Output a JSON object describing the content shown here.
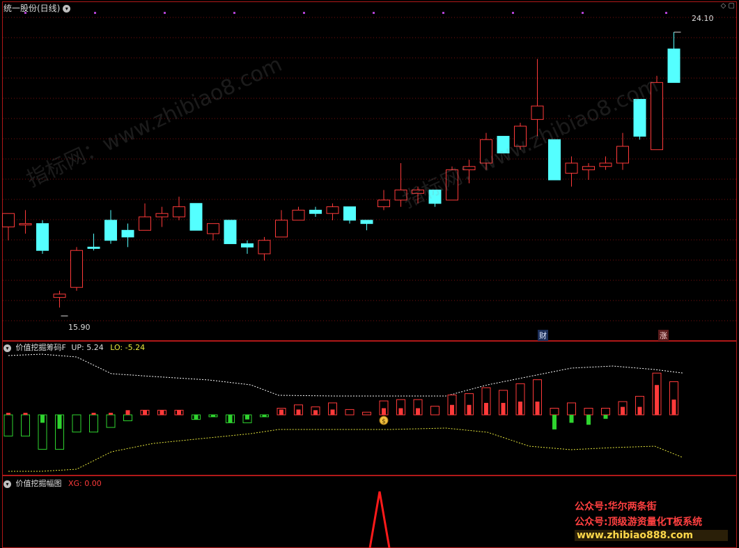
{
  "top_panel": {
    "title": "统一股份(日线)",
    "high_label": "24.10",
    "low_label": "15.90",
    "badge_cai": "财",
    "badge_zhang": "涨",
    "corner_icons": "◇ ▢"
  },
  "mid_panel": {
    "name": "价值挖掘筹码F",
    "up_label": "UP: 5.24",
    "lo_label": "LO: -5.24",
    "money_glyph": "$"
  },
  "bot_panel": {
    "name": "价值挖掘幅图",
    "xg_label": "XG: 0.00"
  },
  "promo": {
    "line1": "公众号:华尔两条街",
    "line2": "公众号:顶级游资量化T板系统",
    "line3": "www.zhibiao888.com"
  },
  "watermark": {
    "text1": "指标网：www.zhibiao",
    "text2": "8.com"
  },
  "colors": {
    "up": "#ff3a3a",
    "down": "#54ffff",
    "border": "#b01818",
    "grid": "#7a1010",
    "ma": "#ffffff",
    "green": "#2fd42f",
    "promo1": "#ff4040",
    "promo3": "#ffd84a"
  },
  "chart_data": [
    {
      "type": "candlestick",
      "ylim": [
        15.3,
        24.6
      ],
      "grid": true,
      "high_marker": 24.1,
      "low_marker": 15.9,
      "candles": [
        {
          "o": 18.3,
          "h": 18.6,
          "l": 17.9,
          "c": 18.7,
          "dir": "up"
        },
        {
          "o": 18.4,
          "h": 18.8,
          "l": 18.1,
          "c": 18.4,
          "dir": "up"
        },
        {
          "o": 18.4,
          "h": 18.5,
          "l": 17.5,
          "c": 17.6,
          "dir": "down"
        },
        {
          "o": 16.2,
          "h": 16.4,
          "l": 15.9,
          "c": 16.3,
          "dir": "up"
        },
        {
          "o": 16.5,
          "h": 17.7,
          "l": 16.4,
          "c": 17.6,
          "dir": "up"
        },
        {
          "o": 17.7,
          "h": 18.1,
          "l": 17.6,
          "c": 17.7,
          "dir": "down"
        },
        {
          "o": 18.5,
          "h": 18.8,
          "l": 17.8,
          "c": 17.9,
          "dir": "down"
        },
        {
          "o": 18.2,
          "h": 18.4,
          "l": 17.7,
          "c": 18.0,
          "dir": "down"
        },
        {
          "o": 18.2,
          "h": 19.0,
          "l": 18.2,
          "c": 18.6,
          "dir": "up"
        },
        {
          "o": 18.6,
          "h": 18.9,
          "l": 18.3,
          "c": 18.7,
          "dir": "up"
        },
        {
          "o": 18.6,
          "h": 19.2,
          "l": 18.5,
          "c": 18.9,
          "dir": "up"
        },
        {
          "o": 19.0,
          "h": 19.0,
          "l": 18.2,
          "c": 18.2,
          "dir": "down"
        },
        {
          "o": 18.1,
          "h": 18.4,
          "l": 17.9,
          "c": 18.4,
          "dir": "up"
        },
        {
          "o": 18.5,
          "h": 18.5,
          "l": 17.8,
          "c": 17.8,
          "dir": "down"
        },
        {
          "o": 17.8,
          "h": 17.9,
          "l": 17.5,
          "c": 17.7,
          "dir": "down"
        },
        {
          "o": 17.5,
          "h": 18.0,
          "l": 17.3,
          "c": 17.9,
          "dir": "up"
        },
        {
          "o": 18.0,
          "h": 18.8,
          "l": 18.0,
          "c": 18.5,
          "dir": "up"
        },
        {
          "o": 18.5,
          "h": 18.9,
          "l": 18.5,
          "c": 18.8,
          "dir": "up"
        },
        {
          "o": 18.8,
          "h": 18.9,
          "l": 18.6,
          "c": 18.7,
          "dir": "down"
        },
        {
          "o": 18.7,
          "h": 19.0,
          "l": 18.5,
          "c": 18.9,
          "dir": "up"
        },
        {
          "o": 18.9,
          "h": 18.9,
          "l": 18.4,
          "c": 18.5,
          "dir": "down"
        },
        {
          "o": 18.5,
          "h": 18.5,
          "l": 18.2,
          "c": 18.4,
          "dir": "down"
        },
        {
          "o": 18.9,
          "h": 19.4,
          "l": 18.8,
          "c": 19.1,
          "dir": "up"
        },
        {
          "o": 19.1,
          "h": 20.2,
          "l": 18.9,
          "c": 19.4,
          "dir": "up"
        },
        {
          "o": 19.3,
          "h": 19.5,
          "l": 19.0,
          "c": 19.4,
          "dir": "up"
        },
        {
          "o": 19.4,
          "h": 19.4,
          "l": 18.9,
          "c": 19.0,
          "dir": "down"
        },
        {
          "o": 19.1,
          "h": 20.1,
          "l": 19.1,
          "c": 20.0,
          "dir": "up"
        },
        {
          "o": 20.0,
          "h": 20.3,
          "l": 19.6,
          "c": 20.1,
          "dir": "up"
        },
        {
          "o": 20.2,
          "h": 21.1,
          "l": 20.0,
          "c": 20.9,
          "dir": "up"
        },
        {
          "o": 21.0,
          "h": 21.0,
          "l": 20.5,
          "c": 20.5,
          "dir": "down"
        },
        {
          "o": 20.7,
          "h": 21.4,
          "l": 20.6,
          "c": 21.3,
          "dir": "up"
        },
        {
          "o": 21.5,
          "h": 23.3,
          "l": 21.0,
          "c": 21.9,
          "dir": "up"
        },
        {
          "o": 20.9,
          "h": 20.9,
          "l": 19.7,
          "c": 19.7,
          "dir": "down"
        },
        {
          "o": 19.9,
          "h": 20.4,
          "l": 19.5,
          "c": 20.2,
          "dir": "up"
        },
        {
          "o": 20.0,
          "h": 20.2,
          "l": 19.7,
          "c": 20.1,
          "dir": "up"
        },
        {
          "o": 20.1,
          "h": 20.4,
          "l": 20.0,
          "c": 20.2,
          "dir": "up"
        },
        {
          "o": 20.2,
          "h": 21.1,
          "l": 20.0,
          "c": 20.7,
          "dir": "up"
        },
        {
          "o": 22.1,
          "h": 22.1,
          "l": 20.9,
          "c": 21.0,
          "dir": "down"
        },
        {
          "o": 20.6,
          "h": 22.8,
          "l": 20.6,
          "c": 22.6,
          "dir": "up"
        },
        {
          "o": 23.6,
          "h": 24.1,
          "l": 22.6,
          "c": 22.6,
          "dir": "down"
        }
      ]
    },
    {
      "type": "bar",
      "ylim": [
        -10,
        10
      ],
      "up_level": 5.24,
      "lo_level": -5.24,
      "bars": [
        {
          "outer": -3.2,
          "inner": 0.3,
          "dir": "neg"
        },
        {
          "outer": -3.2,
          "inner": 0.3,
          "dir": "neg"
        },
        {
          "outer": -5.2,
          "inner": -1.2,
          "dir": "neg"
        },
        {
          "outer": -5.2,
          "inner": -2.1,
          "dir": "neg"
        },
        {
          "outer": -2.6,
          "inner": 0,
          "dir": "neg"
        },
        {
          "outer": -2.6,
          "inner": 0.3,
          "dir": "neg"
        },
        {
          "outer": -1.9,
          "inner": 0.3,
          "dir": "neg"
        },
        {
          "outer": -0.9,
          "inner": 0.7,
          "dir": "neg"
        },
        {
          "outer": 0.7,
          "inner": 0.7,
          "dir": "pos"
        },
        {
          "outer": 0.7,
          "inner": 0.7,
          "dir": "pos"
        },
        {
          "outer": 0.7,
          "inner": 0.7,
          "dir": "pos"
        },
        {
          "outer": -0.7,
          "inner": -0.7,
          "dir": "neg"
        },
        {
          "outer": -0.3,
          "inner": -0.3,
          "dir": "neg"
        },
        {
          "outer": -1.2,
          "inner": -1.2,
          "dir": "neg"
        },
        {
          "outer": -1.2,
          "inner": -0.7,
          "dir": "neg"
        },
        {
          "outer": -0.3,
          "inner": -0.3,
          "dir": "neg"
        },
        {
          "outer": 1.0,
          "inner": 0.8,
          "dir": "pos"
        },
        {
          "outer": 1.5,
          "inner": 0.8,
          "dir": "pos"
        },
        {
          "outer": 1.2,
          "inner": 0.7,
          "dir": "pos"
        },
        {
          "outer": 1.8,
          "inner": 0.8,
          "dir": "pos"
        },
        {
          "outer": 0.8,
          "inner": 0,
          "dir": "pos"
        },
        {
          "outer": 0.4,
          "inner": 0,
          "dir": "pos"
        },
        {
          "outer": 2.1,
          "inner": 1.0,
          "dir": "pos"
        },
        {
          "outer": 2.3,
          "inner": 1.0,
          "dir": "pos"
        },
        {
          "outer": 2.3,
          "inner": 1.0,
          "dir": "pos"
        },
        {
          "outer": 1.3,
          "inner": 0,
          "dir": "pos"
        },
        {
          "outer": 3.0,
          "inner": 1.5,
          "dir": "pos"
        },
        {
          "outer": 3.2,
          "inner": 1.5,
          "dir": "pos"
        },
        {
          "outer": 4.1,
          "inner": 1.8,
          "dir": "pos"
        },
        {
          "outer": 3.7,
          "inner": 1.8,
          "dir": "pos"
        },
        {
          "outer": 4.7,
          "inner": 2.0,
          "dir": "pos"
        },
        {
          "outer": 5.3,
          "inner": 2.0,
          "dir": "pos"
        },
        {
          "outer": 1.0,
          "inner": -2.2,
          "dir": "pos"
        },
        {
          "outer": 1.8,
          "inner": -1.2,
          "dir": "pos"
        },
        {
          "outer": 1.0,
          "inner": -1.5,
          "dir": "pos"
        },
        {
          "outer": 1.0,
          "inner": -0.6,
          "dir": "pos"
        },
        {
          "outer": 2.0,
          "inner": 1.2,
          "dir": "pos"
        },
        {
          "outer": 2.8,
          "inner": 1.2,
          "dir": "pos"
        },
        {
          "outer": 6.3,
          "inner": 4.5,
          "dir": "pos"
        },
        {
          "outer": 5.0,
          "inner": 2.3,
          "dir": "pos"
        }
      ]
    },
    {
      "type": "line",
      "ylim": [
        0,
        1
      ],
      "spike_index": 22,
      "xg_value": 0.0
    }
  ]
}
